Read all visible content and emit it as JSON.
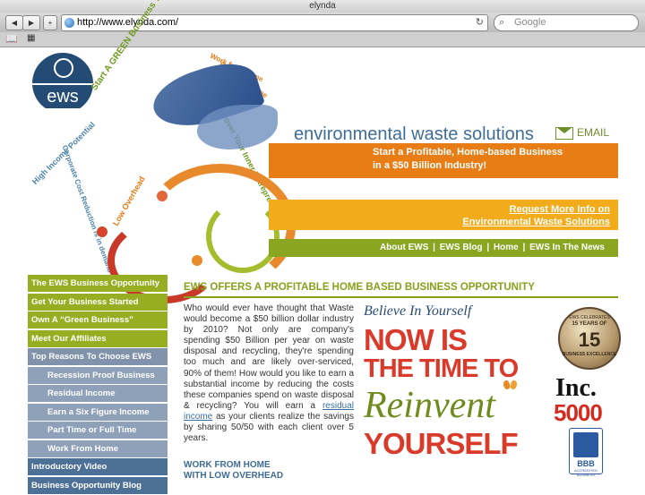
{
  "browser": {
    "window_title": "elynda",
    "back_label": "◀",
    "forward_label": "▶",
    "add_label": "+",
    "url": "http://www.elynda.com/",
    "reload_label": "↻",
    "search_placeholder": "Google"
  },
  "header": {
    "logo_text": "ews",
    "site_title": "environmental waste solutions",
    "email_label": "EMAIL",
    "slogans": {
      "green_business": "Start A GREEN Business Today",
      "work_home": "Work from Home",
      "full_part": "Full or Part-Time",
      "inner_entrepreneur": "Discover Your Inner Entrepreneur",
      "income_potential": "High Income Potential",
      "cost_reduction": "Corporate Cost Reduction is in demand",
      "low_overhead": "Low Overhead"
    }
  },
  "banner": {
    "line1": "Start a Profitable, Home-based Business",
    "line2": "in a $50 Billion Industry!",
    "request_line1": "Request More Info on",
    "request_line2": "Environmental Waste Solutions"
  },
  "topnav": {
    "about": "About EWS",
    "sep1": "|",
    "blog": "EWS Blog",
    "sep2": "|",
    "home": "Home",
    "sep3": "|",
    "news": "EWS In The News"
  },
  "sidebar": {
    "items": [
      {
        "label": "The EWS Business Opportunity"
      },
      {
        "label": "Get Your Business Started"
      },
      {
        "label": "Own A “Green Business”"
      },
      {
        "label": "Meet Our Affiliates"
      },
      {
        "label": "Top Reasons To Choose EWS"
      },
      {
        "label": "Recession Proof Business"
      },
      {
        "label": "Residual Income"
      },
      {
        "label": "Earn a Six Figure Income"
      },
      {
        "label": "Part Time or Full Time"
      },
      {
        "label": "Work From Home"
      },
      {
        "label": "Introductory Video"
      },
      {
        "label": "Business Opportunity Blog"
      }
    ]
  },
  "main": {
    "heading": "EWS OFFERS A PROFITABLE HOME BASED BUSINESS OPPORTUNITY",
    "para_before": "Who would ever have thought that Waste would become a $50 billion dollar industry by 2010? Not only are company's spending $50 Billion per year on waste disposal and recycling, they're spending too much and are likely over-serviced, 90% of them! How would you like to earn a substantial income by reducing the costs these companies spend on waste disposal & recycling? You will earn a",
    "para_link": "residual income",
    "para_after": "as your clients realize the savings by sharing 50/50 with each client over 5 years.",
    "work_line1": "WORK FROM HOME",
    "work_line2": "WITH LOW OVERHEAD"
  },
  "promo": {
    "believe": "Believe In Yourself",
    "now_is": "NOW IS",
    "time_to": "THE TIME TO",
    "reinvent": "Reinvent",
    "yourself": "YOURSELF"
  },
  "badges": {
    "award_top": "EWS CELEBRATES",
    "award_years": "15 YEARS OF",
    "award_num": "15",
    "award_bottom": "BUSINESS EXCELLENCE",
    "inc": "Inc.",
    "inc5000": "5000",
    "bbb": "BBB",
    "bbb_sub": "ACCREDITED BUSINESS"
  }
}
